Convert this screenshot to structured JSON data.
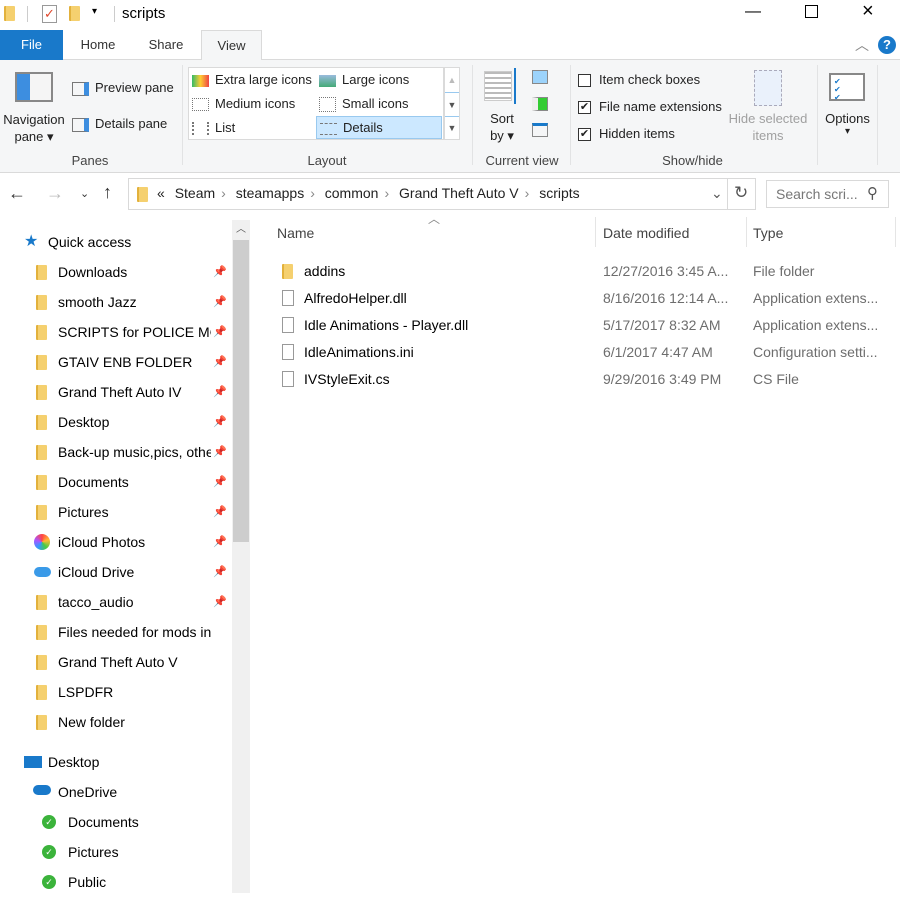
{
  "window": {
    "title": "scripts"
  },
  "tabs": [
    {
      "label": "File"
    },
    {
      "label": "Home"
    },
    {
      "label": "Share"
    },
    {
      "label": "View"
    }
  ],
  "ribbon": {
    "panes": {
      "navigation_pane": "Navigation",
      "navigation_pane2": "pane",
      "preview_pane": "Preview pane",
      "details_pane": "Details pane",
      "label": "Panes"
    },
    "layout": {
      "options": [
        "Extra large icons",
        "Large icons",
        "Medium icons",
        "Small icons",
        "List",
        "Details"
      ],
      "selected": "Details",
      "label": "Layout"
    },
    "current_view": {
      "sort_by": "Sort",
      "sort_by2": "by",
      "label": "Current view"
    },
    "show_hide": {
      "item_check_boxes": {
        "label": "Item check boxes",
        "checked": false
      },
      "file_name_extensions": {
        "label": "File name extensions",
        "checked": true
      },
      "hidden_items": {
        "label": "Hidden items",
        "checked": true
      },
      "hide_selected": "Hide selected",
      "hide_selected2": "items",
      "label": "Show/hide"
    },
    "options": {
      "label": "Options"
    }
  },
  "address": {
    "overflow": "«",
    "crumbs": [
      "Steam",
      "steamapps",
      "common",
      "Grand Theft Auto V",
      "scripts"
    ],
    "search_placeholder": "Search scri..."
  },
  "nav": {
    "quick_access": "Quick access",
    "items": [
      {
        "label": "Downloads"
      },
      {
        "label": "smooth Jazz"
      },
      {
        "label": "SCRIPTS for POLICE MOD"
      },
      {
        "label": "GTAIV ENB FOLDER"
      },
      {
        "label": "Grand Theft Auto IV"
      },
      {
        "label": "Desktop"
      },
      {
        "label": "Back-up music,pics, other"
      },
      {
        "label": "Documents"
      },
      {
        "label": "Pictures"
      },
      {
        "label": "iCloud Photos"
      },
      {
        "label": "iCloud Drive"
      },
      {
        "label": "tacco_audio"
      },
      {
        "label": "Files needed for mods international"
      },
      {
        "label": "Grand Theft Auto V"
      },
      {
        "label": "LSPDFR"
      },
      {
        "label": "New folder"
      }
    ],
    "desktop": "Desktop",
    "onedrive": "OneDrive",
    "onedrive_items": [
      {
        "label": "Documents"
      },
      {
        "label": "Pictures"
      },
      {
        "label": "Public"
      }
    ]
  },
  "columns": {
    "name": "Name",
    "date": "Date modified",
    "type": "Type"
  },
  "files": [
    {
      "name": "addins",
      "date": "12/27/2016 3:45 A...",
      "type": "File folder",
      "kind": "folder"
    },
    {
      "name": "AlfredoHelper.dll",
      "date": "8/16/2016 12:14 A...",
      "type": "Application extens...",
      "kind": "dll"
    },
    {
      "name": "Idle Animations - Player.dll",
      "date": "5/17/2017 8:32 AM",
      "type": "Application extens...",
      "kind": "dll"
    },
    {
      "name": "IdleAnimations.ini",
      "date": "6/1/2017 4:47 AM",
      "type": "Configuration setti...",
      "kind": "ini"
    },
    {
      "name": "IVStyleExit.cs",
      "date": "9/29/2016 3:49 PM",
      "type": "CS File",
      "kind": "file"
    }
  ],
  "colors": {
    "accent": "#1979ca",
    "selected": "#cce8ff"
  }
}
